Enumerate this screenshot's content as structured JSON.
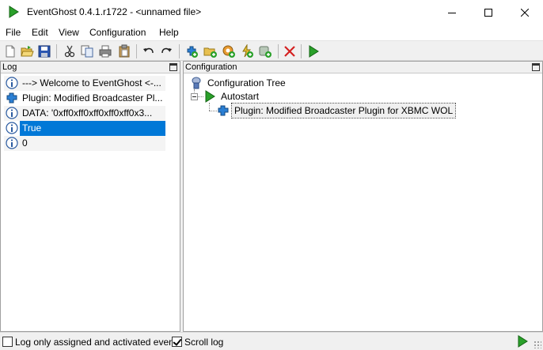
{
  "window": {
    "title": "EventGhost 0.4.1.r1722 - <unnamed file>"
  },
  "menu": {
    "items": [
      "File",
      "Edit",
      "View",
      "Configuration",
      "Help"
    ]
  },
  "toolbar": {
    "buttons": [
      "new-file",
      "open-folder",
      "save",
      "cut",
      "copy",
      "print",
      "paste",
      "undo",
      "redo",
      "add-plugin",
      "add-folder",
      "add-macro",
      "add-event",
      "add-action",
      "delete",
      "execute"
    ]
  },
  "log": {
    "title": "Log",
    "rows": [
      {
        "icon": "info-icon",
        "text": "---> Welcome to EventGhost <-..."
      },
      {
        "icon": "plugin-icon",
        "text": "Plugin: Modified Broadcaster Pl..."
      },
      {
        "icon": "info-icon",
        "text": "DATA: '0xff0xff0xff0xff0xff0x3..."
      },
      {
        "icon": "info-icon",
        "text": "True",
        "selected": true
      },
      {
        "icon": "info-icon",
        "text": "0"
      }
    ]
  },
  "config": {
    "title": "Configuration",
    "tree": {
      "root": "Configuration Tree",
      "autostart": "Autostart",
      "plugin": "Plugin: Modified Broadcaster Plugin for XBMC WOL"
    }
  },
  "status": {
    "log_only_label": "Log only assigned and activated events",
    "log_only_checked": false,
    "scroll_log_label": "Scroll log",
    "scroll_log_checked": true
  },
  "colors": {
    "selection": "#0078d7",
    "play_green": "#2aa02a",
    "delete_red": "#d42020",
    "plugin_blue": "#2a7fd4"
  }
}
